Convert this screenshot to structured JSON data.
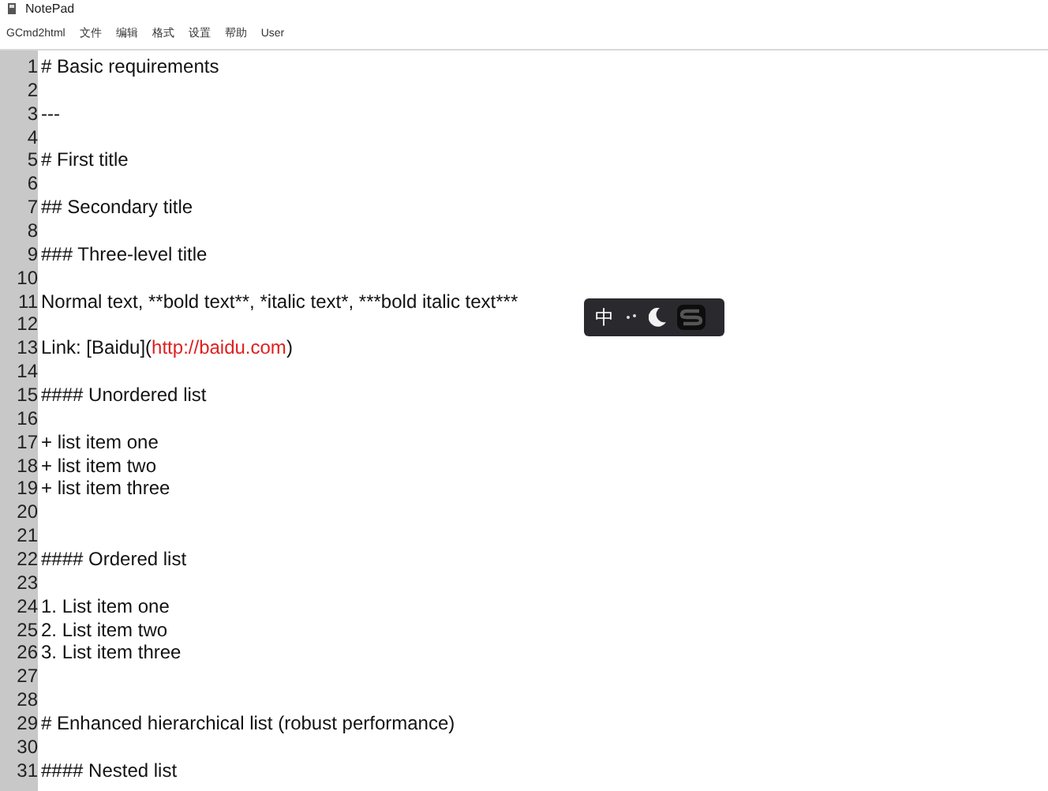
{
  "window": {
    "title": "NotePad"
  },
  "menu": [
    "GCmd2html",
    "文件",
    "编辑",
    "格式",
    "设置",
    "帮助",
    "User"
  ],
  "editor": {
    "lines": [
      {
        "number": "1",
        "parts": [
          {
            "kind": "plain",
            "text": "# Basic requirements"
          }
        ]
      },
      {
        "number": "2"
      },
      {
        "number": "3",
        "parts": [
          {
            "kind": "plain",
            "text": "---"
          }
        ]
      },
      {
        "number": "4"
      },
      {
        "number": "5",
        "parts": [
          {
            "kind": "plain",
            "text": "# First title"
          }
        ]
      },
      {
        "number": "6"
      },
      {
        "number": "7",
        "parts": [
          {
            "kind": "plain",
            "text": "## Secondary title"
          }
        ]
      },
      {
        "number": "8"
      },
      {
        "number": "9",
        "parts": [
          {
            "kind": "plain",
            "text": "### Three-level title"
          }
        ]
      },
      {
        "number": "10"
      },
      {
        "number": "11",
        "parts": [
          {
            "kind": "plain",
            "text": "Normal text, **bold text**, *italic text*, ***bold italic text***"
          }
        ]
      },
      {
        "number": "12"
      },
      {
        "number": "13",
        "parts": [
          {
            "kind": "plain",
            "text": "Link: [Baidu]("
          },
          {
            "kind": "link",
            "text": "http://baidu.com"
          },
          {
            "kind": "plain",
            "text": ")"
          }
        ]
      },
      {
        "number": "14"
      },
      {
        "number": "15",
        "parts": [
          {
            "kind": "plain",
            "text": "#### Unordered list"
          }
        ]
      },
      {
        "number": "16"
      },
      {
        "number": "17",
        "parts": [
          {
            "kind": "plain",
            "text": "+ list item one"
          }
        ]
      },
      {
        "number": "18",
        "parts": [
          {
            "kind": "plain",
            "text": "+ list item two"
          }
        ]
      },
      {
        "number": "19",
        "parts": [
          {
            "kind": "plain",
            "text": "+ list item three"
          }
        ]
      },
      {
        "number": "20"
      },
      {
        "number": "21"
      },
      {
        "number": "22",
        "parts": [
          {
            "kind": "plain",
            "text": "#### Ordered list"
          }
        ]
      },
      {
        "number": "23"
      },
      {
        "number": "24",
        "parts": [
          {
            "kind": "plain",
            "text": "1. List item one"
          }
        ]
      },
      {
        "number": "25",
        "parts": [
          {
            "kind": "plain",
            "text": "2. List item two"
          }
        ]
      },
      {
        "number": "26",
        "parts": [
          {
            "kind": "plain",
            "text": "3. List item three"
          }
        ]
      },
      {
        "number": "27"
      },
      {
        "number": "28"
      },
      {
        "number": "29",
        "parts": [
          {
            "kind": "plain",
            "text": "# Enhanced hierarchical list (robust performance)"
          }
        ]
      },
      {
        "number": "30"
      },
      {
        "number": "31",
        "parts": [
          {
            "kind": "plain",
            "text": "#### Nested list"
          }
        ]
      }
    ]
  },
  "ime_toolbar": {
    "mode": "中"
  }
}
